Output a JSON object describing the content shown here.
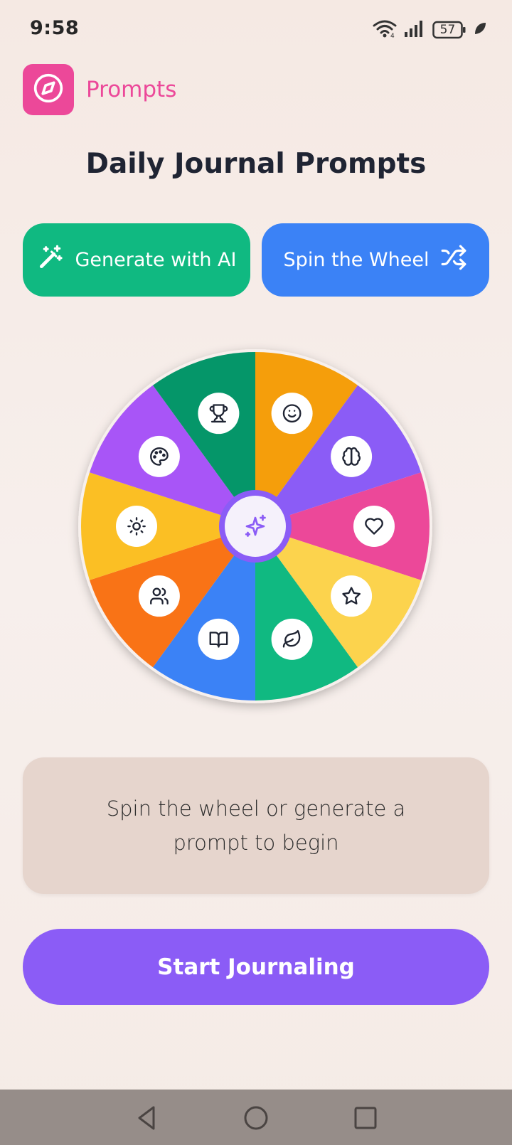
{
  "status_bar": {
    "time": "9:58",
    "battery": "57",
    "icons": [
      "wifi-icon",
      "signal-icon",
      "battery-icon",
      "leaf-icon"
    ]
  },
  "header": {
    "app_icon": "compass-icon",
    "title": "Prompts",
    "accent": "#ec4899"
  },
  "page_title": "Daily Journal Prompts",
  "actions": {
    "generate_label": "Generate with AI",
    "generate_icon": "magic-wand-icon",
    "generate_color": "#10b981",
    "spin_label": "Spin the Wheel",
    "spin_icon": "shuffle-icon",
    "spin_color": "#3b82f6"
  },
  "wheel": {
    "center_icon": "sparkles-icon",
    "segments": [
      {
        "color": "#f59e0b",
        "icon": "smile-icon"
      },
      {
        "color": "#8b5cf6",
        "icon": "brain-icon"
      },
      {
        "color": "#ec4899",
        "icon": "heart-icon"
      },
      {
        "color": "#fcd34d",
        "icon": "star-icon"
      },
      {
        "color": "#10b981",
        "icon": "leaf-icon"
      },
      {
        "color": "#3b82f6",
        "icon": "book-icon"
      },
      {
        "color": "#f97316",
        "icon": "users-icon"
      },
      {
        "color": "#fbbf24",
        "icon": "sun-icon"
      },
      {
        "color": "#a855f7",
        "icon": "palette-icon"
      },
      {
        "color": "#059669",
        "icon": "trophy-icon"
      }
    ]
  },
  "prompt_card": {
    "text": "Spin the wheel or generate a prompt to begin"
  },
  "start_button": {
    "label": "Start Journaling",
    "color": "#8b5cf6"
  },
  "nav": {
    "back": "back-icon",
    "home": "home-icon",
    "recents": "recents-icon"
  }
}
